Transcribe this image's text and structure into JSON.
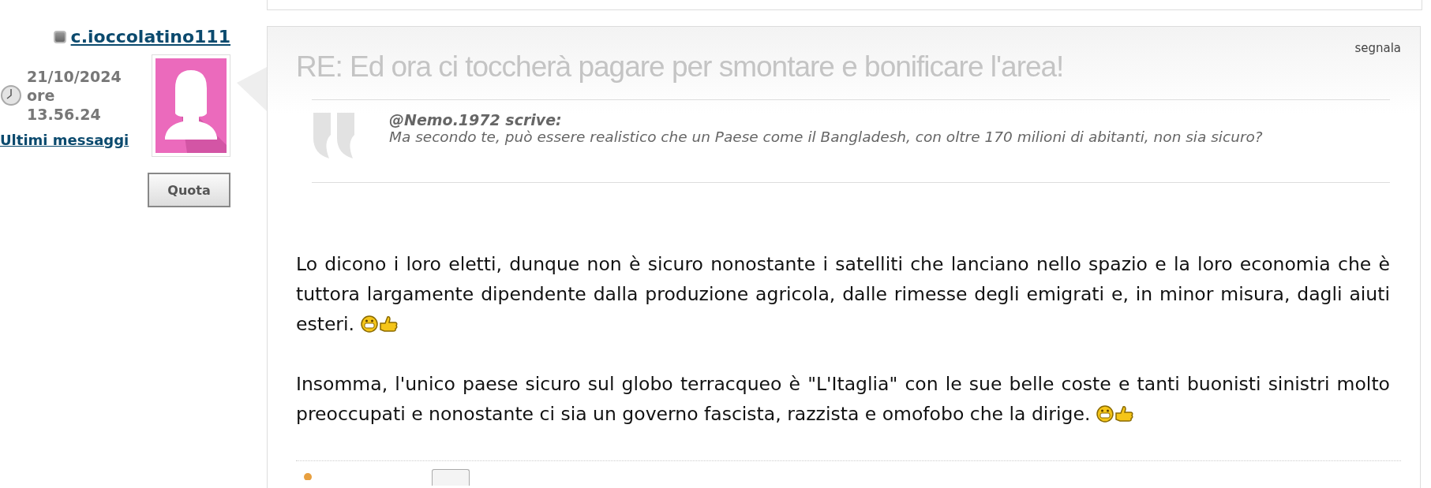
{
  "author": {
    "name": "c.ioccolatino111",
    "date_lines": [
      "21/10/2024",
      "ore",
      "13.56.24"
    ],
    "recent_link": "Ultimi messaggi",
    "quote_button": "Quota"
  },
  "post": {
    "title": "RE: Ed ora ci toccherà pagare per smontare e bonificare l'area!",
    "report_link": "segnala",
    "quote": {
      "author": "@Nemo.1972 scrive:",
      "text": "Ma secondo te, può essere realistico che un Paese come il Bangladesh, con oltre 170 milioni di abitanti, non sia sicuro?"
    },
    "paragraphs": [
      {
        "text": "Lo dicono i loro eletti, dunque non è sicuro nonostante i satelliti che lanciano nello spazio e la loro economia che è tuttora largamente dipendente dalla produzione agricola, dalle rimesse degli emigrati e, in minor misura, dagli aiuti esteri.",
        "emoticons": [
          {
            "kind": "grin"
          },
          {
            "kind": "thumbs-up"
          }
        ]
      },
      {
        "text": "Insomma, l'unico paese sicuro sul globo terracqueo è \"L'Itaglia\" con le sue belle coste e tanti buonisti sinistri molto preoccupati e nonostante ci sia un governo fascista, razzista e omofobo che la dirige.",
        "emoticons": [
          {
            "kind": "grin"
          },
          {
            "kind": "thumbs-up"
          }
        ]
      }
    ]
  }
}
